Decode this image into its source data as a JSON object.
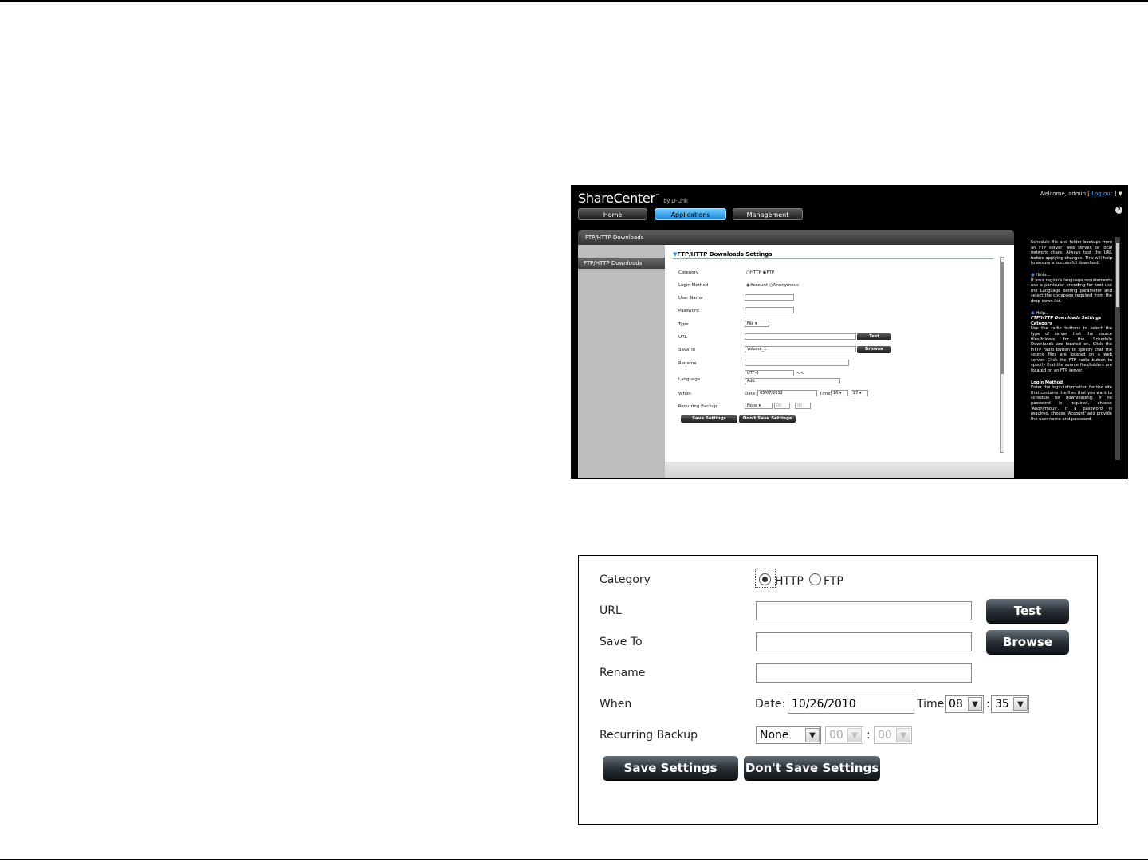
{
  "shot1": {
    "brand": "ShareCenter",
    "brand_tm": "™",
    "brand_by": "by D-Link",
    "welcome_prefix": "Welcome, admin [",
    "logout_label": "Log out",
    "welcome_suffix": "] ▼",
    "help_icon": "?",
    "nav_tabs": [
      "Home",
      "Applications",
      "Management"
    ],
    "active_tab": "Applications",
    "panel_title": "FTP/HTTP Downloads",
    "left_nav_item": "FTP/HTTP Downloads",
    "section_title": "FTP/HTTP Downloads Settings",
    "labels": {
      "category": "Category",
      "login_method": "Login Method",
      "user_name": "User Name",
      "password": "Password",
      "type": "Type",
      "url": "URL",
      "save_to": "Save To",
      "rename": "Rename",
      "language": "Language",
      "when": "When",
      "recurring": "Recurring Backup"
    },
    "category_options": [
      "HTTP",
      "FTP"
    ],
    "category_selected": "FTP",
    "login_options": [
      "Account",
      "Anonymous"
    ],
    "login_selected": "Account",
    "type_value": "File",
    "save_to_value": "Volume_1",
    "language_value": "UTF-8",
    "language_more": "<<",
    "language_add": "Add",
    "date_label": "Date:",
    "date_value": "03/07/2012",
    "time_label": "Time:",
    "time_hour": "16",
    "time_min": "27",
    "recurring_value": "None",
    "recurring_hour": "00",
    "recurring_min": "00",
    "test_button": "Test",
    "browse_button": "Browse",
    "save_button": "Save Settings",
    "dont_save_button": "Don't Save Settings",
    "help_text": {
      "intro": "Schedule file and folder backups from an FTP server, web server, or local network share. Always test the URL before applying changes. This will help to ensure a successful download.",
      "hints_title": "Hints...",
      "hints_text": "If your region's language requirements use a particular encoding for text use the Language setting parameter and select the codepage required from the drop-down list.",
      "help_title": "Help...",
      "help_sub": "FTP/HTTP Downloads Settings",
      "category_title": "Category",
      "category_text": "Use the radio buttons to select the type of server that the source files/folders for the Schedule Downloads are located on. Click the HTTP radio button to specify that the source files are located on a web server. Click the FTP radio button to specify that the source files/folders are located on an FTP server.",
      "login_title": "Login Method",
      "login_text": "Enter the login information for the site that contains the files that you want to schedule for downloading. If no password is required, choose 'Anonymous'. If a password is required, choose 'Account' and provide the user name and password."
    }
  },
  "shot2": {
    "labels": {
      "category": "Category",
      "url": "URL",
      "save_to": "Save To",
      "rename": "Rename",
      "when": "When",
      "recurring": "Recurring Backup"
    },
    "category_options": [
      "HTTP",
      "FTP"
    ],
    "category_selected": "HTTP",
    "date_label": "Date:",
    "date_value": "10/26/2010",
    "time_label": "Time:",
    "time_hour": "08",
    "time_sep": ":",
    "time_min": "35",
    "recurring_value": "None",
    "recurring_hour": "00",
    "recurring_min": "00",
    "test_button": "Test",
    "browse_button": "Browse",
    "save_button": "Save Settings",
    "dont_save_button": "Don't Save Settings",
    "dropdown_arrow": "▼"
  }
}
